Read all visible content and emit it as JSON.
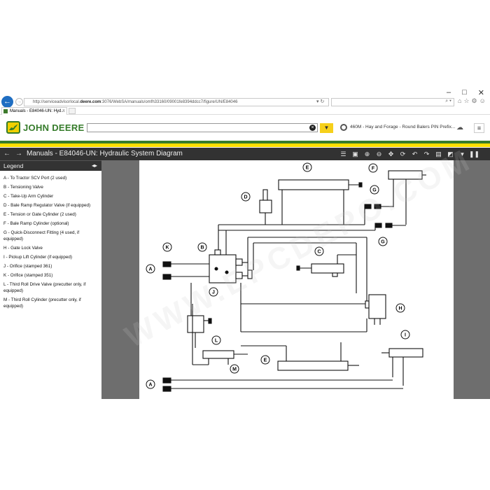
{
  "browser": {
    "url_prefix": "http://serviceadvisorlocal.",
    "url_domain": "deere.com",
    "url_rest": ":3076/WebSA/manuals/omfh33160/09001fe8394ddcc7/figure/UN/E84046",
    "tab_title": "Manuals - E84046-UN: Hyd...",
    "tab_close": "×"
  },
  "header": {
    "brand": "JOHN DEERE",
    "search_value": "",
    "model_label": "460M - Hay and Forage - Round Balers PIN Prefix..."
  },
  "titlebar": {
    "title": "Manuals - E84046-UN: Hydraulic System Diagram"
  },
  "legend": {
    "title": "Legend",
    "items": [
      "A - To Tractor SCV Port (2 used)",
      "B - Tensioning Valve",
      "C - Take-Up Arm Cylinder",
      "D - Bale Ramp Regulator Valve (if equipped)",
      "E - Tension or Gate Cylinder (2 used)",
      "F - Bale Ramp Cylinder (optional)",
      "G - Quick-Disconnect Fitting (4 used, if equipped)",
      "H - Gate Lock Valve",
      "I - Pickup Lift Cylinder (if equipped)",
      "J - Orifice (stamped 361)",
      "K - Orifice (stamped 351)",
      "L - Third Roll Drive Valve (precutter only, if equipped)",
      "M - Third Roll Cylinder (precutter only, if equipped)"
    ]
  },
  "diagram": {
    "labels": [
      "A",
      "B",
      "C",
      "D",
      "E",
      "F",
      "G",
      "H",
      "I",
      "J",
      "K",
      "L",
      "M"
    ]
  },
  "watermark": "WWW.EPCDEPO.COM"
}
